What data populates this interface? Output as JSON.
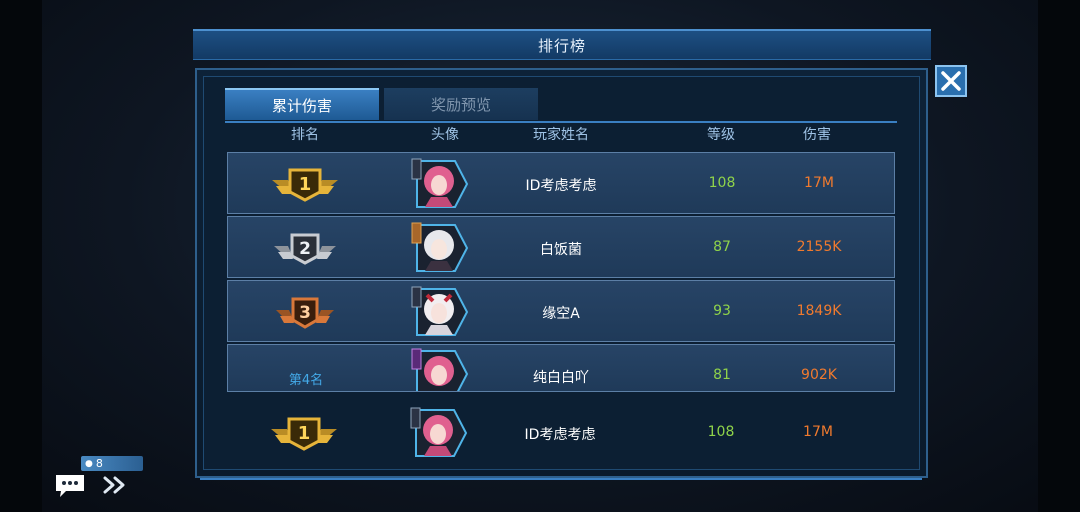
{
  "title": "排行榜",
  "tabs": [
    {
      "label": "累计伤害",
      "active": true
    },
    {
      "label": "奖励预览",
      "active": false
    }
  ],
  "columns": {
    "rank": "排名",
    "avatar": "头像",
    "name": "玩家姓名",
    "level": "等级",
    "damage": "伤害"
  },
  "rows": [
    {
      "rank": "1",
      "rank_text": "",
      "name": "ID考虑考虑",
      "level": "108",
      "damage": "17M",
      "badge_color": "#e6b43a",
      "hair": "#e0608f"
    },
    {
      "rank": "2",
      "rank_text": "",
      "name": "白饭菌",
      "level": "87",
      "damage": "2155K",
      "badge_color": "#c8ccd2",
      "hair": "#e8e8ec"
    },
    {
      "rank": "3",
      "rank_text": "",
      "name": "缘空A",
      "level": "93",
      "damage": "1849K",
      "badge_color": "#d9783a",
      "hair": "#f2eef0"
    },
    {
      "rank": "4",
      "rank_text": "第4名",
      "name": "纯白白吖",
      "level": "81",
      "damage": "902K",
      "badge_color": "",
      "hair": "#e0608f"
    }
  ],
  "my_row": {
    "rank": "1",
    "name": "ID考虑考虑",
    "level": "108",
    "damage": "17M",
    "badge_color": "#e6b43a",
    "hair": "#e0608f"
  },
  "chat": {
    "count": "8"
  },
  "colors": {
    "accent": "#3a7fc2",
    "level": "#8fd34a",
    "damage": "#f07a2e"
  }
}
